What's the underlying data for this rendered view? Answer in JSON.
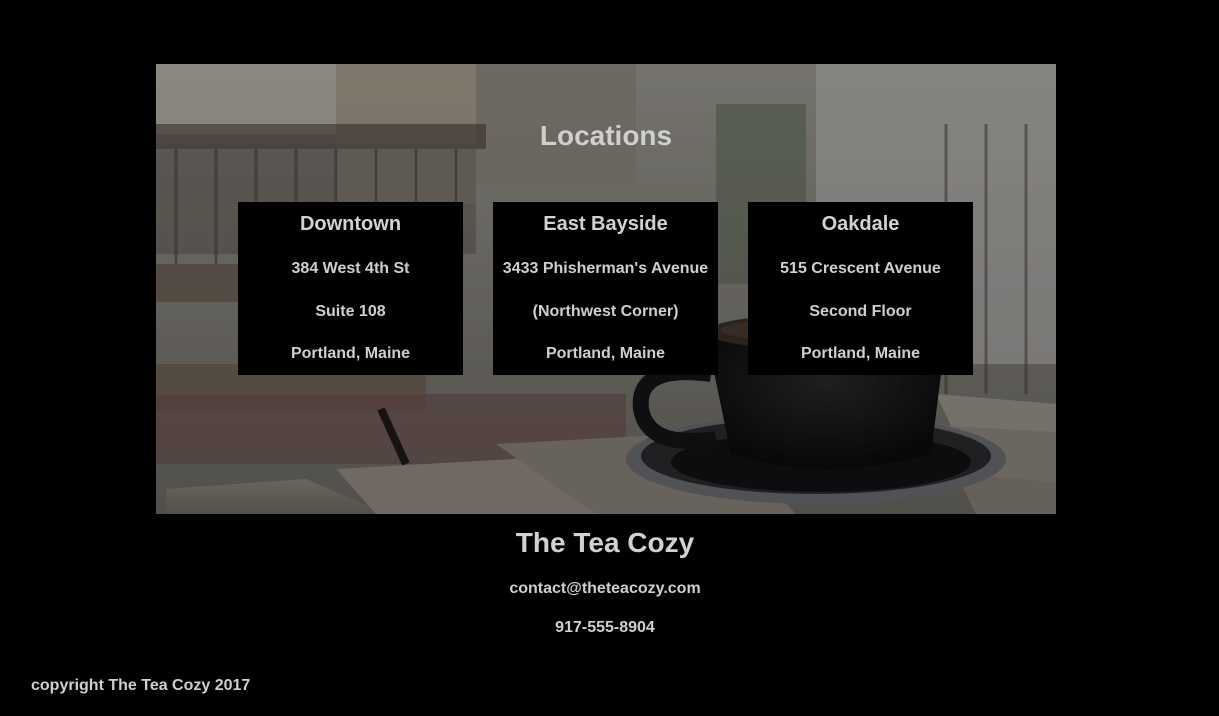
{
  "locations_section": {
    "title": "Locations",
    "cards": [
      {
        "name": "Downtown",
        "line1": "384 West 4th St",
        "line2": "Suite 108",
        "line3": "Portland, Maine"
      },
      {
        "name": "East Bayside",
        "line1": "3433 Phisherman's Avenue",
        "line2": "(Northwest Corner)",
        "line3": "Portland, Maine"
      },
      {
        "name": "Oakdale",
        "line1": "515 Crescent Avenue",
        "line2": "Second Floor",
        "line3": "Portland, Maine"
      }
    ]
  },
  "footer": {
    "title": "The Tea Cozy",
    "email": "contact@theteacozy.com",
    "phone": "917-555-8904",
    "copyright": "copyright The Tea Cozy 2017"
  },
  "colors": {
    "page_background": "#000000",
    "text": "#d2d2d2",
    "card_background": "#000000"
  }
}
